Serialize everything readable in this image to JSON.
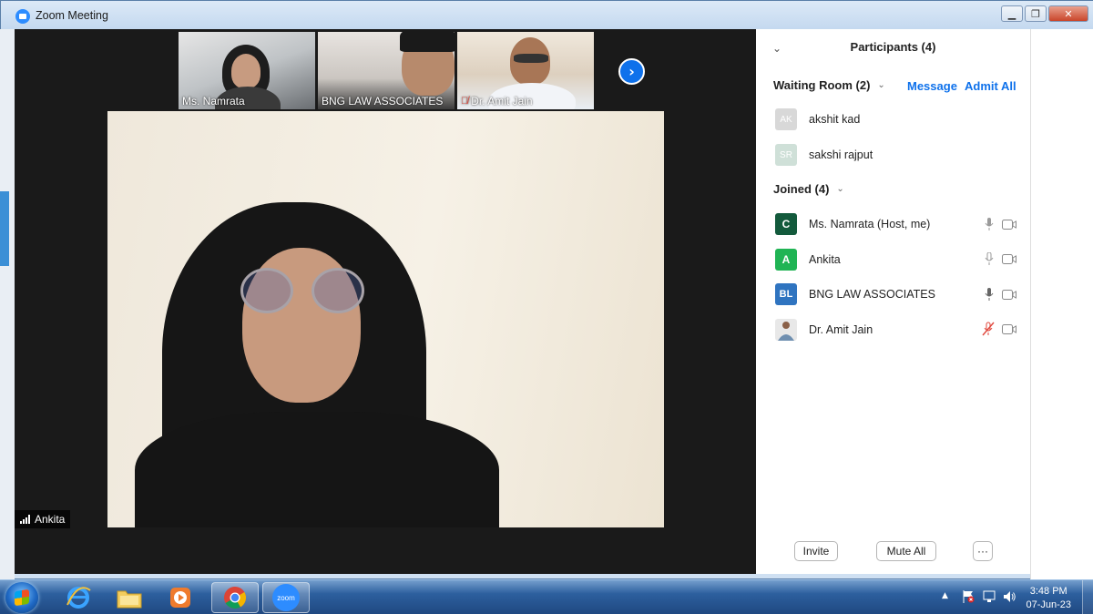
{
  "window": {
    "title": "Zoom Meeting"
  },
  "gallery": {
    "thumbnails": [
      {
        "name": "Ms. Namrata",
        "muted": false
      },
      {
        "name": "BNG LAW ASSOCIATES",
        "muted": false
      },
      {
        "name": "Dr. Amit Jain",
        "muted": true
      }
    ]
  },
  "active_speaker": {
    "name": "Ankita"
  },
  "participants": {
    "title": "Participants (4)",
    "waiting_room": {
      "label": "Waiting Room (2)",
      "message_label": "Message",
      "admit_all_label": "Admit All",
      "people": [
        {
          "initials": "AK",
          "name": "akshit kad"
        },
        {
          "initials": "SR",
          "name": "sakshi rajput"
        }
      ]
    },
    "joined": {
      "label": "Joined (4)",
      "people": [
        {
          "initials": "C",
          "name": "Ms. Namrata (Host, me)",
          "mic": "off-grey",
          "color": "#135a3c"
        },
        {
          "initials": "A",
          "name": "Ankita",
          "mic": "on-grey",
          "color": "#20b454"
        },
        {
          "initials": "BL",
          "name": "BNG LAW ASSOCIATES",
          "mic": "on",
          "color": "#2f74c0"
        },
        {
          "initials": "",
          "name": "Dr. Amit Jain",
          "mic": "muted",
          "color": "#e8e8e8"
        }
      ]
    },
    "buttons": {
      "invite": "Invite",
      "mute_all": "Mute All",
      "more": "···"
    }
  },
  "taskbar": {
    "time": "3:48 PM",
    "date": "07-Jun-23",
    "apps": [
      "internet-explorer-icon",
      "file-explorer-icon",
      "media-player-icon",
      "chrome-icon",
      "zoom-icon"
    ],
    "zoom_label": "zoom"
  }
}
